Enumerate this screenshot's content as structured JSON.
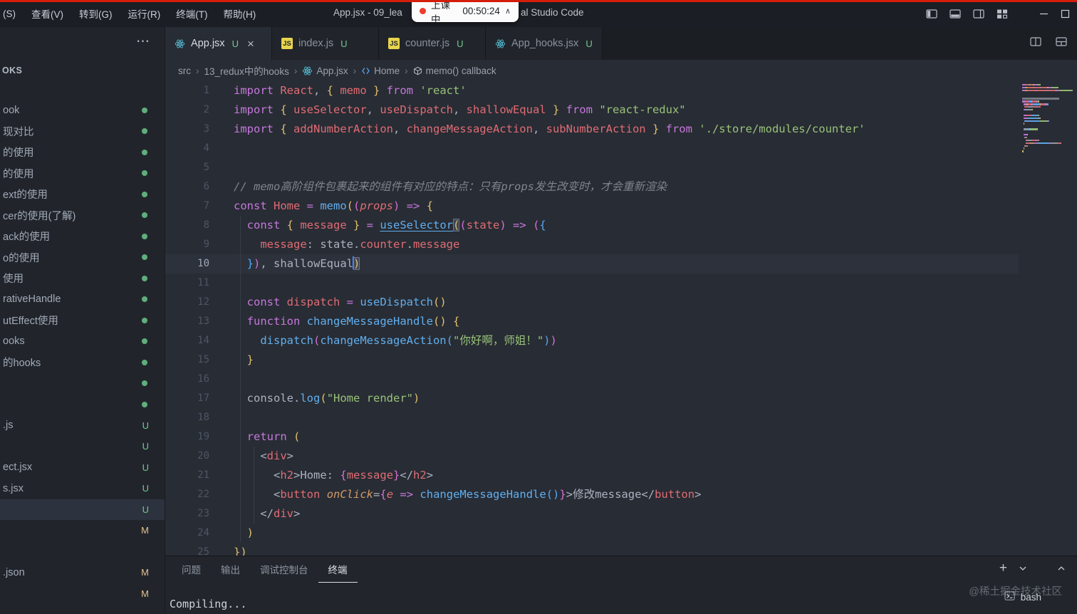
{
  "colors": {
    "accent": "#528bff",
    "recording_red": "#d41d0a",
    "git_untracked": "#73c991",
    "git_modified": "#e2c08d",
    "react_icon": "#58c4dc",
    "js_icon": "#e8d44d",
    "keyword": "#c678dd",
    "variable": "#e06c75",
    "function": "#61afef",
    "string": "#98c379",
    "comment": "#7f848e",
    "bracket1": "#e0c06e",
    "bracket2": "#d670d6",
    "bracket3": "#58a7f0"
  },
  "title_bar": {
    "menus": [
      "(S)",
      "查看(V)",
      "转到(G)",
      "运行(R)",
      "终端(T)",
      "帮助(H)"
    ],
    "title_left": "App.jsx - 09_lea",
    "title_right": "al Studio Code",
    "recording": {
      "label": "上课中",
      "time": "00:50:24"
    }
  },
  "tabs": [
    {
      "label": "App.jsx",
      "icon": "react",
      "status": "U",
      "active": true
    },
    {
      "label": "index.js",
      "icon": "js",
      "status": "U",
      "active": false
    },
    {
      "label": "counter.js",
      "icon": "js",
      "status": "U",
      "active": false
    },
    {
      "label": "App_hooks.jsx",
      "icon": "react",
      "status": "U",
      "active": false
    }
  ],
  "breadcrumb": [
    {
      "label": "src",
      "icon": ""
    },
    {
      "label": "13_redux中的hooks",
      "icon": ""
    },
    {
      "label": "App.jsx",
      "icon": "react"
    },
    {
      "label": "Home",
      "icon": "symbol"
    },
    {
      "label": "memo() callback",
      "icon": "cube"
    }
  ],
  "sidebar": {
    "header": "OKS",
    "more_icon": "⋯",
    "items": [
      {
        "label": "ook",
        "badge": "dot",
        "active": false
      },
      {
        "label": "现对比",
        "badge": "dot",
        "active": false
      },
      {
        "label": "的使用",
        "badge": "dot",
        "active": false
      },
      {
        "label": "的使用",
        "badge": "dot",
        "active": false
      },
      {
        "label": "ext的使用",
        "badge": "dot",
        "active": false
      },
      {
        "label": "cer的使用(了解)",
        "badge": "dot",
        "active": false
      },
      {
        "label": "ack的使用",
        "badge": "dot",
        "active": false
      },
      {
        "label": "o的使用",
        "badge": "dot",
        "active": false
      },
      {
        "label": "使用",
        "badge": "dot",
        "active": false
      },
      {
        "label": "rativeHandle",
        "badge": "dot",
        "active": false
      },
      {
        "label": "utEffect使用",
        "badge": "dot",
        "active": false
      },
      {
        "label": "ooks",
        "badge": "dot",
        "active": false
      },
      {
        "label": "的hooks",
        "badge": "dot",
        "active": false
      },
      {
        "label": "",
        "badge": "dot",
        "active": false
      },
      {
        "label": "",
        "badge": "dot",
        "active": false
      },
      {
        "label": ".js",
        "badge": "U",
        "active": false
      },
      {
        "label": "",
        "badge": "U",
        "active": false
      },
      {
        "label": "ect.jsx",
        "badge": "U",
        "active": false
      },
      {
        "label": "s.jsx",
        "badge": "U",
        "active": false
      },
      {
        "label": "",
        "badge": "U",
        "active": true
      },
      {
        "label": "",
        "badge": "M",
        "active": false
      },
      {
        "label": "",
        "badge": "",
        "active": false
      },
      {
        "label": ".json",
        "badge": "M",
        "active": false
      },
      {
        "label": "",
        "badge": "M",
        "active": false
      }
    ]
  },
  "editor": {
    "active_line": 10,
    "lines": [
      {
        "n": 1,
        "ind": 0,
        "tk": [
          [
            "import ",
            "kw"
          ],
          [
            "React",
            "var"
          ],
          [
            ", ",
            "pln"
          ],
          [
            "{ ",
            "b1"
          ],
          [
            "memo",
            "var"
          ],
          [
            " }",
            "b1"
          ],
          [
            " from ",
            "kw"
          ],
          [
            "'react'",
            "str"
          ]
        ]
      },
      {
        "n": 2,
        "ind": 0,
        "tk": [
          [
            "import ",
            "kw"
          ],
          [
            "{ ",
            "b1"
          ],
          [
            "useSelector",
            "var"
          ],
          [
            ", ",
            "pln"
          ],
          [
            "useDispatch",
            "var"
          ],
          [
            ", ",
            "pln"
          ],
          [
            "shallowEqual",
            "var"
          ],
          [
            " }",
            "b1"
          ],
          [
            " from ",
            "kw"
          ],
          [
            "\"react-redux\"",
            "str"
          ]
        ]
      },
      {
        "n": 3,
        "ind": 0,
        "tk": [
          [
            "import ",
            "kw"
          ],
          [
            "{ ",
            "b1"
          ],
          [
            "addNumberAction",
            "var"
          ],
          [
            ", ",
            "pln"
          ],
          [
            "changeMessageAction",
            "var"
          ],
          [
            ", ",
            "pln"
          ],
          [
            "subNumberAction",
            "var"
          ],
          [
            " }",
            "b1"
          ],
          [
            " from ",
            "kw"
          ],
          [
            "'./store/modules/counter'",
            "str"
          ]
        ]
      },
      {
        "n": 4,
        "ind": 0,
        "tk": []
      },
      {
        "n": 5,
        "ind": 0,
        "tk": []
      },
      {
        "n": 6,
        "ind": 0,
        "tk": [
          [
            "// memo高阶组件包裹起来的组件有对应的特点：只有props发生改变时，才会重新渲染",
            "cmt"
          ]
        ]
      },
      {
        "n": 7,
        "ind": 0,
        "tk": [
          [
            "const ",
            "kw"
          ],
          [
            "Home",
            "var"
          ],
          [
            " = ",
            "kw"
          ],
          [
            "memo",
            "fn"
          ],
          [
            "(",
            "b1"
          ],
          [
            "(",
            "b2"
          ],
          [
            "props",
            "var i"
          ],
          [
            ")",
            "b2"
          ],
          [
            " ",
            "pln"
          ],
          [
            "=>",
            "kw"
          ],
          [
            " ",
            "pln"
          ],
          [
            "{",
            "b1"
          ]
        ]
      },
      {
        "n": 8,
        "ind": 2,
        "tk": [
          [
            "const ",
            "kw"
          ],
          [
            "{ ",
            "b1"
          ],
          [
            "message",
            "var"
          ],
          [
            " }",
            "b1"
          ],
          [
            " = ",
            "kw"
          ],
          [
            "useSelector",
            "fn u"
          ],
          [
            "(",
            "b1 m"
          ],
          [
            "(",
            "b2"
          ],
          [
            "state",
            "var"
          ],
          [
            ")",
            "b2"
          ],
          [
            " ",
            "pln"
          ],
          [
            "=>",
            "kw"
          ],
          [
            " ",
            "pln"
          ],
          [
            "(",
            "b2"
          ],
          [
            "{",
            "b3"
          ]
        ]
      },
      {
        "n": 9,
        "ind": 4,
        "tk": [
          [
            "message",
            "var"
          ],
          [
            ": ",
            "pln"
          ],
          [
            "state",
            "pln"
          ],
          [
            ".",
            "pln"
          ],
          [
            "counter",
            "var"
          ],
          [
            ".",
            "pln"
          ],
          [
            "message",
            "var"
          ]
        ]
      },
      {
        "n": 10,
        "ind": 2,
        "tk": [
          [
            "}",
            "b3"
          ],
          [
            ")",
            "b2"
          ],
          [
            ", ",
            "pln"
          ],
          [
            "shallowEqual",
            "pln"
          ],
          [
            "",
            "cursor"
          ],
          [
            ")",
            "b1 m"
          ]
        ]
      },
      {
        "n": 11,
        "ind": 0,
        "tk": []
      },
      {
        "n": 12,
        "ind": 2,
        "tk": [
          [
            "const ",
            "kw"
          ],
          [
            "dispatch",
            "var"
          ],
          [
            " = ",
            "kw"
          ],
          [
            "useDispatch",
            "fn"
          ],
          [
            "()",
            "b1"
          ]
        ]
      },
      {
        "n": 13,
        "ind": 2,
        "tk": [
          [
            "function ",
            "kw"
          ],
          [
            "changeMessageHandle",
            "fn"
          ],
          [
            "()",
            "b1"
          ],
          [
            " ",
            "pln"
          ],
          [
            "{",
            "b1"
          ]
        ]
      },
      {
        "n": 14,
        "ind": 4,
        "tk": [
          [
            "dispatch",
            "fn"
          ],
          [
            "(",
            "b2"
          ],
          [
            "changeMessageAction",
            "fn"
          ],
          [
            "(",
            "b3"
          ],
          [
            "\"你好啊，师姐！\"",
            "str"
          ],
          [
            ")",
            "b3"
          ],
          [
            ")",
            "b2"
          ]
        ]
      },
      {
        "n": 15,
        "ind": 2,
        "tk": [
          [
            "}",
            "b1"
          ]
        ]
      },
      {
        "n": 16,
        "ind": 0,
        "tk": []
      },
      {
        "n": 17,
        "ind": 2,
        "tk": [
          [
            "console",
            "pln"
          ],
          [
            ".",
            "pln"
          ],
          [
            "log",
            "fn"
          ],
          [
            "(",
            "b1"
          ],
          [
            "\"Home render\"",
            "str"
          ],
          [
            ")",
            "b1"
          ]
        ]
      },
      {
        "n": 18,
        "ind": 0,
        "tk": []
      },
      {
        "n": 19,
        "ind": 2,
        "tk": [
          [
            "return ",
            "kw"
          ],
          [
            "(",
            "b1"
          ]
        ]
      },
      {
        "n": 20,
        "ind": 4,
        "tk": [
          [
            "<",
            "pln"
          ],
          [
            "div",
            "var"
          ],
          [
            ">",
            "pln"
          ]
        ]
      },
      {
        "n": 21,
        "ind": 6,
        "tk": [
          [
            "<",
            "pln"
          ],
          [
            "h2",
            "var"
          ],
          [
            ">",
            "pln"
          ],
          [
            "Home: ",
            "pln"
          ],
          [
            "{",
            "b2"
          ],
          [
            "message",
            "var"
          ],
          [
            "}",
            "b2"
          ],
          [
            "</",
            "pln"
          ],
          [
            "h2",
            "var"
          ],
          [
            ">",
            "pln"
          ]
        ]
      },
      {
        "n": 22,
        "ind": 6,
        "tk": [
          [
            "<",
            "pln"
          ],
          [
            "button",
            "var"
          ],
          [
            " ",
            "pln"
          ],
          [
            "onClick",
            "attr i"
          ],
          [
            "=",
            "pln"
          ],
          [
            "{",
            "b2"
          ],
          [
            "e",
            "var i"
          ],
          [
            " ",
            "pln"
          ],
          [
            "=>",
            "kw"
          ],
          [
            " ",
            "pln"
          ],
          [
            "changeMessageHandle",
            "fn"
          ],
          [
            "()",
            "b3"
          ],
          [
            "}",
            "b2"
          ],
          [
            ">",
            "pln"
          ],
          [
            "修改message",
            "pln"
          ],
          [
            "</",
            "pln"
          ],
          [
            "button",
            "var"
          ],
          [
            ">",
            "pln"
          ]
        ]
      },
      {
        "n": 23,
        "ind": 4,
        "tk": [
          [
            "</",
            "pln"
          ],
          [
            "div",
            "var"
          ],
          [
            ">",
            "pln"
          ]
        ]
      },
      {
        "n": 24,
        "ind": 2,
        "tk": [
          [
            ")",
            "b1"
          ]
        ]
      },
      {
        "n": 25,
        "ind": 0,
        "tk": [
          [
            "})",
            "b1"
          ]
        ]
      }
    ]
  },
  "panel": {
    "tabs": [
      {
        "label": "问题",
        "active": false
      },
      {
        "label": "输出",
        "active": false
      },
      {
        "label": "调试控制台",
        "active": false
      },
      {
        "label": "终端",
        "active": true
      }
    ],
    "content": "Compiling...",
    "terminal_list": [
      {
        "label": "bash"
      }
    ],
    "watermark": "@稀土掘金技术社区"
  }
}
